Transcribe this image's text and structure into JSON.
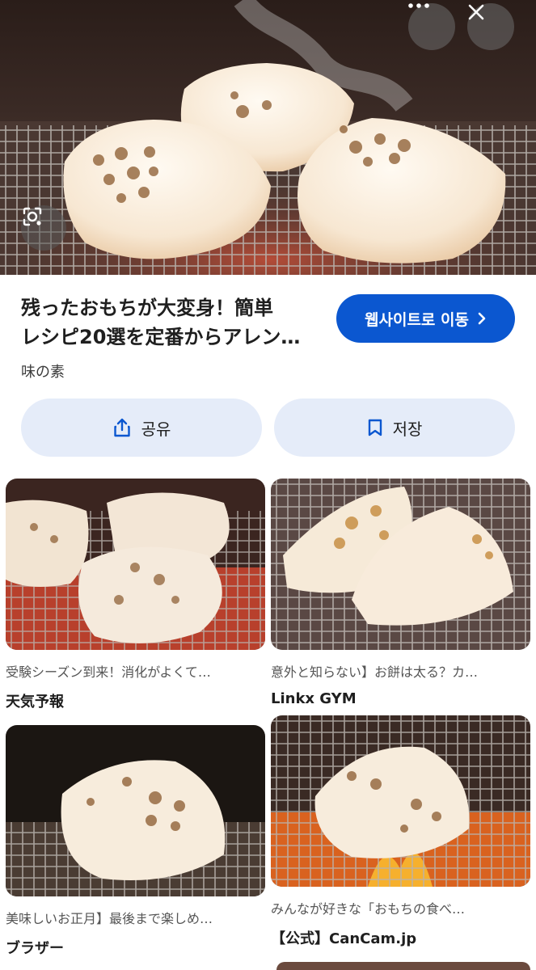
{
  "hero": {
    "lens_icon": "lens-icon",
    "more_icon": "more-icon",
    "close_icon": "close-icon"
  },
  "result": {
    "title_line1": "残ったおもちが大変身！簡単",
    "title_line2": "レシピ20選を定番からアレン…",
    "source": "味の素",
    "visit_label": "웹사이트로 이동"
  },
  "actions": {
    "share_label": "공유",
    "save_label": "저장"
  },
  "related": [
    {
      "snippet": "受験シーズン到来！消化がよくて…",
      "site": "天気予報"
    },
    {
      "snippet": "意外と知らない】お餅は太る？カ…",
      "site": "Linkx GYM"
    },
    {
      "snippet": "美味しいお正月】最後まで楽しめ…",
      "site": "ブラザー"
    },
    {
      "snippet": "みんなが好きな「おもちの食べ…",
      "site": "【公式】CanCam.jp"
    }
  ],
  "colors": {
    "accent": "#0b57d0",
    "button_bg": "#e5ecf9"
  }
}
